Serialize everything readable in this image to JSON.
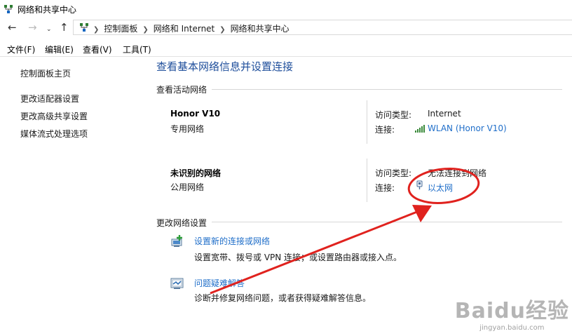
{
  "window": {
    "title": "网络和共享中心"
  },
  "addressbar": {
    "breadcrumbs": [
      "控制面板",
      "网络和 Internet",
      "网络和共享中心"
    ]
  },
  "menubar": {
    "items": [
      "文件(F)",
      "编辑(E)",
      "查看(V)",
      "工具(T)"
    ]
  },
  "sidebar": {
    "items": [
      "控制面板主页",
      "更改适配器设置",
      "更改高级共享设置",
      "媒体流式处理选项"
    ]
  },
  "main": {
    "heading": "查看基本网络信息并设置连接",
    "active_section": "查看活动网络",
    "networks": [
      {
        "name": "Honor V10",
        "type": "专用网络",
        "access_label": "访问类型:",
        "access_value": "Internet",
        "conn_label": "连接:",
        "conn_value": "WLAN (Honor V10)"
      },
      {
        "name": "未识别的网络",
        "type": "公用网络",
        "access_label": "访问类型:",
        "access_value": "无法连接到网络",
        "conn_label": "连接:",
        "conn_value": "以太网"
      }
    ],
    "change_section": "更改网络设置",
    "tasks": [
      {
        "title": "设置新的连接或网络",
        "desc": "设置宽带、拨号或 VPN 连接；或设置路由器或接入点。"
      },
      {
        "title": "问题疑难解答",
        "desc": "诊断并修复网络问题，或者获得疑难解答信息。"
      }
    ]
  },
  "watermark": {
    "text": "Baidu经验",
    "sub": "jingyan.baidu.com"
  },
  "colors": {
    "link": "#1f6ec9",
    "heading": "#1e4e9b",
    "annotation": "#e0221e"
  }
}
